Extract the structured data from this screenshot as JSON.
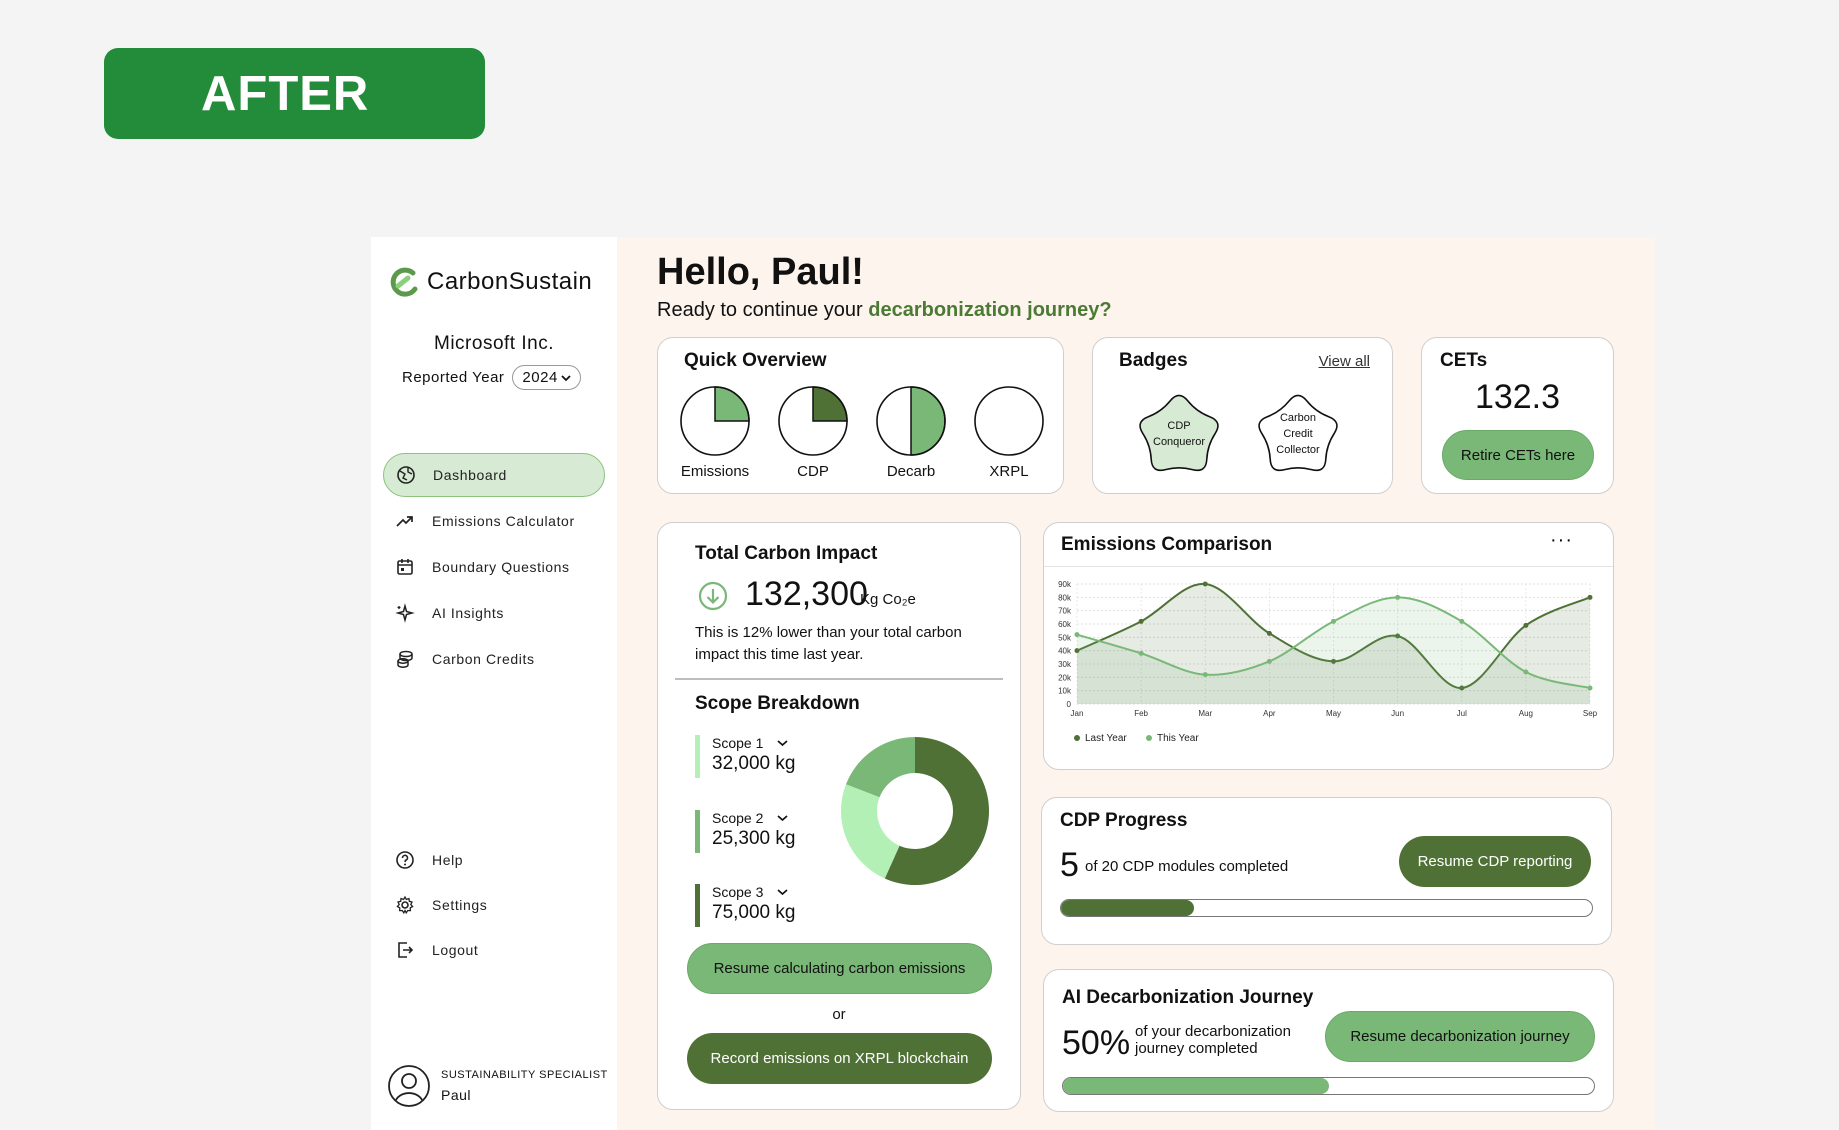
{
  "after_label": "AFTER",
  "brand": {
    "name": "CarbonSustain"
  },
  "company": {
    "name": "Microsoft Inc.",
    "year_label": "Reported Year",
    "year_value": "2024"
  },
  "nav": {
    "items": [
      {
        "label": "Dashboard",
        "icon": "globe-icon",
        "active": true
      },
      {
        "label": "Emissions Calculator",
        "icon": "trend-up-icon"
      },
      {
        "label": "Boundary Questions",
        "icon": "calendar-icon"
      },
      {
        "label": "AI Insights",
        "icon": "sparkle-icon"
      },
      {
        "label": "Carbon Credits",
        "icon": "coins-icon"
      }
    ],
    "bottom": [
      {
        "label": "Help",
        "icon": "help-icon"
      },
      {
        "label": "Settings",
        "icon": "gear-icon"
      },
      {
        "label": "Logout",
        "icon": "logout-icon"
      }
    ]
  },
  "user": {
    "role": "SUSTAINABILITY SPECIALIST",
    "name": "Paul"
  },
  "greeting": {
    "title": "Hello, Paul!",
    "subtitle_prefix": "Ready to continue your ",
    "subtitle_accent": "decarbonization journey?"
  },
  "quick_overview": {
    "title": "Quick Overview",
    "items": [
      {
        "label": "Emissions",
        "fraction": 0.25,
        "color": "#7ab878"
      },
      {
        "label": "CDP",
        "fraction": 0.25,
        "color": "#4f7136"
      },
      {
        "label": "Decarb",
        "fraction": 0.5,
        "color": "#7ab878"
      },
      {
        "label": "XRPL",
        "fraction": 0,
        "color": "#7ab878"
      }
    ]
  },
  "badges": {
    "title": "Badges",
    "view_all": "View all",
    "items": [
      {
        "lines": [
          "CDP",
          "Conqueror"
        ],
        "fill": "#d7ebd4"
      },
      {
        "lines": [
          "Carbon",
          "Credit",
          "Collector"
        ],
        "fill": "#ffffff"
      }
    ]
  },
  "cets": {
    "title": "CETs",
    "value": "132.3",
    "button": "Retire CETs here"
  },
  "total_impact": {
    "title": "Total Carbon Impact",
    "value": "132,300",
    "unit": "Kg Co₂e",
    "description": "This is 12% lower than your total carbon impact this time last year.",
    "scope_title": "Scope Breakdown",
    "scopes": [
      {
        "label": "Scope 1",
        "value": "32,000 kg",
        "color": "#b3f0b5"
      },
      {
        "label": "Scope 2",
        "value": "25,300 kg",
        "color": "#7ab878"
      },
      {
        "label": "Scope 3",
        "value": "75,000 kg",
        "color": "#4f7136"
      }
    ],
    "button_resume": "Resume calculating carbon emissions",
    "or": "or",
    "button_record": "Record emissions on XRPL blockchain"
  },
  "comparison": {
    "title": "Emissions Comparison",
    "more": "···"
  },
  "chart_data": {
    "type": "line",
    "x": [
      "Jan",
      "Feb",
      "Mar",
      "Apr",
      "May",
      "Jun",
      "Jul",
      "Aug",
      "Sep"
    ],
    "yticks": [
      "0",
      "10k",
      "20k",
      "30k",
      "40k",
      "50k",
      "60k",
      "70k",
      "80k",
      "90k"
    ],
    "ylim": [
      0,
      90000
    ],
    "series": [
      {
        "name": "Last Year",
        "color": "#4f7136",
        "values": [
          40000,
          62000,
          90000,
          53000,
          32000,
          51000,
          12000,
          59000,
          80000
        ]
      },
      {
        "name": "This Year",
        "color": "#7ab878",
        "values": [
          52000,
          38000,
          22000,
          32000,
          62000,
          80000,
          62000,
          24000,
          12000
        ]
      }
    ],
    "grid": true,
    "legend": "bottom-left"
  },
  "cdp": {
    "title": "CDP Progress",
    "count": "5",
    "text": "of 20 CDP modules completed",
    "button": "Resume CDP reporting",
    "progress": 0.25
  },
  "ai_journey": {
    "title": "AI Decarbonization Journey",
    "percent": "50%",
    "text": "of your decarbonization journey completed",
    "button": "Resume decarbonization journey",
    "progress": 0.5
  }
}
